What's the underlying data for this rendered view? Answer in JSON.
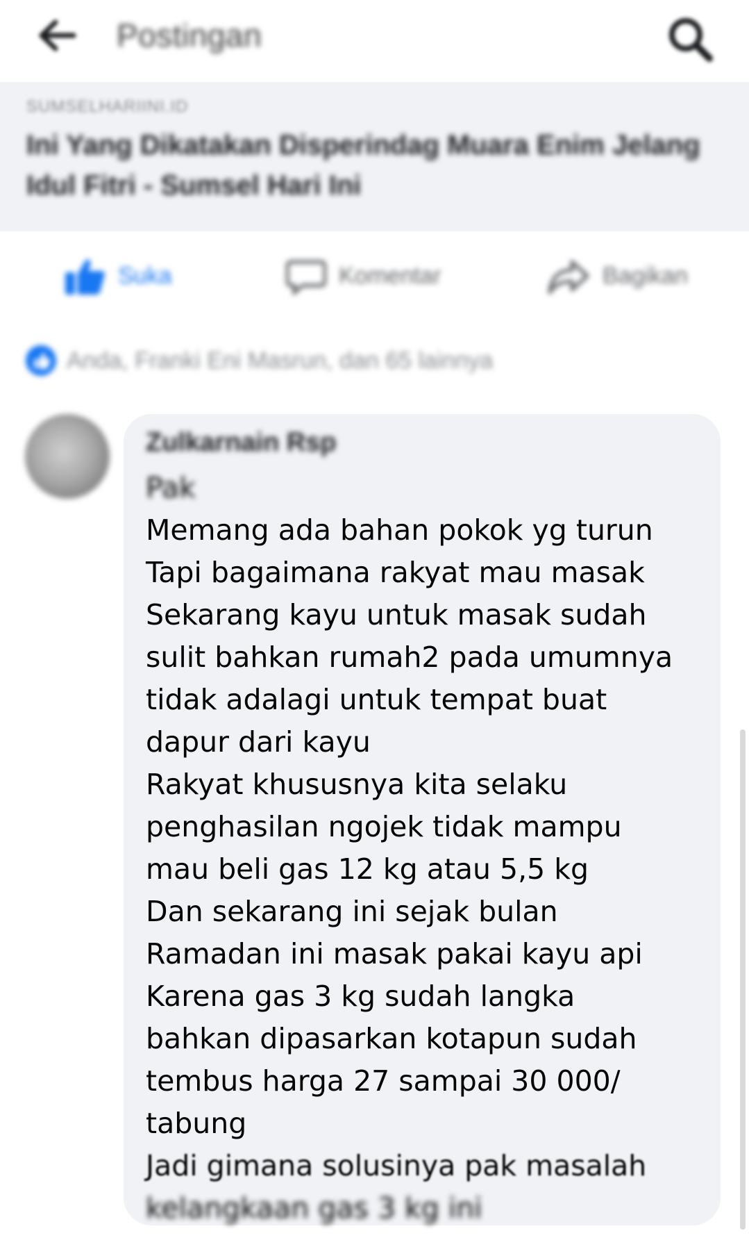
{
  "header": {
    "title": "Postingan",
    "back_icon": "back-arrow-icon",
    "search_icon": "search-icon"
  },
  "link_preview": {
    "source": "SUMSELHARIINI.ID",
    "title": "Ini Yang Dikatakan Disperindag Muara Enim Jelang Idul Fitri - Sumsel Hari Ini"
  },
  "actions": {
    "like_label": "Suka",
    "comment_label": "Komentar",
    "share_label": "Bagikan"
  },
  "reactions": {
    "summary": "Anda, Franki Eni Masrun, dan 65 lainnya"
  },
  "comment": {
    "author": "Zulkarnain Rsp",
    "lines": [
      "Pak",
      "Memang ada bahan pokok yg turun",
      "Tapi bagaimana rakyat mau masak",
      "Sekarang kayu untuk masak sudah",
      "sulit bahkan rumah2 pada umumnya",
      "tidak adalagi untuk tempat buat",
      "dapur dari kayu",
      "Rakyat khususnya kita selaku",
      "penghasilan ngojek tidak mampu",
      "mau beli gas 12 kg atau 5,5 kg",
      "Dan sekarang ini sejak bulan",
      "Ramadan ini masak pakai kayu api",
      "Karena gas 3 kg sudah langka",
      "bahkan dipasarkan kotapun sudah",
      "tembus harga 27 sampai 30 000/",
      "tabung",
      "Jadi gimana solusinya pak masalah",
      "kelangkaan gas 3 kg ini"
    ]
  },
  "colors": {
    "brand_blue": "#1877f2",
    "bubble_bg": "#f0f2f5",
    "text": "#050505"
  }
}
